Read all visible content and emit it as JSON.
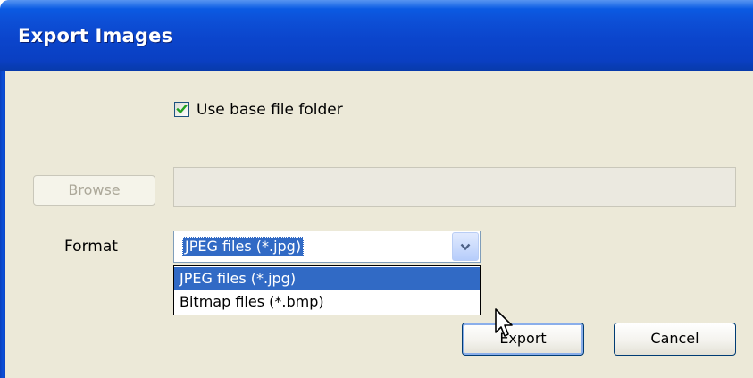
{
  "window": {
    "title": "Export Images"
  },
  "options": {
    "use_base_folder_label": "Use base file folder",
    "use_base_folder_checked": true
  },
  "path": {
    "browse_label": "Browse",
    "folder_value": ""
  },
  "format": {
    "label": "Format",
    "selected": "JPEG files (*.jpg)",
    "options": [
      "JPEG files (*.jpg)",
      "Bitmap files (*.bmp)"
    ]
  },
  "actions": {
    "export_label": "Export",
    "cancel_label": "Cancel"
  },
  "icons": {
    "checkmark": "check-icon",
    "dropdown_arrow": "chevron-down-icon",
    "cursor": "mouse-pointer-icon"
  },
  "colors": {
    "titlebar": "#0b45cc",
    "dialog_background": "#ece9d8",
    "selection": "#316ac5",
    "checkmark": "#21a121"
  }
}
